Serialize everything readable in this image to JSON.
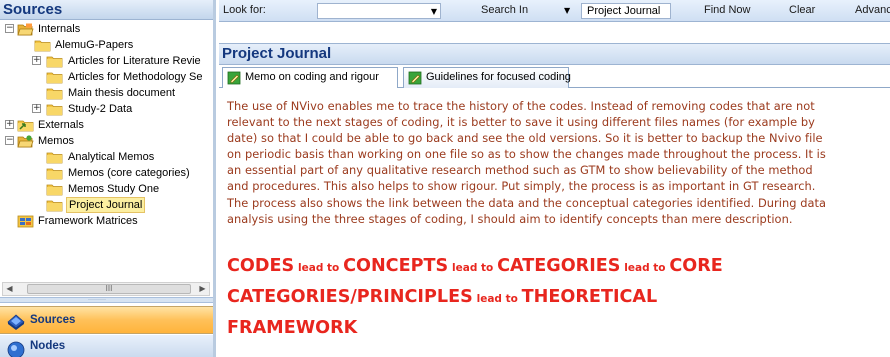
{
  "nav": {
    "title": "Sources",
    "tree": [
      {
        "label": "Internals",
        "expander": "−",
        "icon": "folder-open-icon"
      },
      {
        "label": "AlemuG-Papers",
        "expander": "",
        "icon": "folder-icon"
      },
      {
        "label": "Articles for Literature Revie",
        "expander": "+",
        "icon": "folder-icon"
      },
      {
        "label": "Articles for Methodology Se",
        "expander": "",
        "icon": "folder-icon"
      },
      {
        "label": "Main thesis document",
        "expander": "",
        "icon": "folder-icon"
      },
      {
        "label": "Study-2 Data",
        "expander": "+",
        "icon": "folder-icon"
      },
      {
        "label": "Externals",
        "expander": "+",
        "icon": "folder-external-icon"
      },
      {
        "label": "Memos",
        "expander": "−",
        "icon": "folder-memo-icon"
      },
      {
        "label": "Analytical Memos",
        "expander": "",
        "icon": "folder-icon"
      },
      {
        "label": "Memos (core categories)",
        "expander": "",
        "icon": "folder-icon"
      },
      {
        "label": "Memos Study One",
        "expander": "",
        "icon": "folder-icon"
      },
      {
        "label": "Project Journal",
        "expander": "",
        "icon": "folder-icon",
        "selected": true
      },
      {
        "label": "Framework Matrices",
        "expander": "",
        "icon": "framework-matrix-icon"
      }
    ],
    "scroll_thumb_glyph": "III",
    "splitter_glyph": "·········",
    "buttons": {
      "sources": "Sources",
      "nodes": "Nodes"
    }
  },
  "findbar": {
    "look_for_label": "Look for:",
    "look_for_value": "",
    "search_in_label": "Search In",
    "search_in_value": "Project Journal",
    "find_now": "Find Now",
    "clear": "Clear",
    "advanced": "Advanc"
  },
  "content": {
    "title": "Project Journal",
    "tabs": [
      {
        "label": "Memo on coding and rigour",
        "active": true
      },
      {
        "label": "Guidelines for focused coding",
        "active": false
      }
    ],
    "body_lines": [
      "The use of NVivo enables me to trace the history of the codes. Instead of removing codes that are not",
      "relevant to the next stages of coding, it is better to save it using different files names (for example by",
      "date) so that I could be able to go back and see the old versions. So it is better to backup the Nvivo file",
      "on periodic basis than working on one file so as to show the changes made throughout the process. It is",
      "an essential part of any qualitative research method such as GTM to show believability of the method",
      "and procedures. This also helps to show rigour. Put simply, the process is as important in GT research.",
      "The process also shows the link between the data and the conceptual categories identified. During data",
      "analysis using the three stages of coding, I should aim to identify concepts than mere description."
    ],
    "heading": {
      "codes": "CODES",
      "lead1": "lead to",
      "concepts": "CONCEPTS",
      "lead2": "lead to",
      "categories": "CATEGORIES",
      "lead3": "lead to",
      "core": "CORE",
      "core_categories": "CATEGORIES/PRINCIPLES",
      "lead4": "lead to",
      "theoretical": "THEORETICAL",
      "framework": "FRAMEWORK"
    }
  },
  "colors": {
    "accent_title": "#14387e",
    "body_text": "#9b3a1d",
    "heading_text": "#e8261e",
    "selection": "#fcefa1"
  }
}
